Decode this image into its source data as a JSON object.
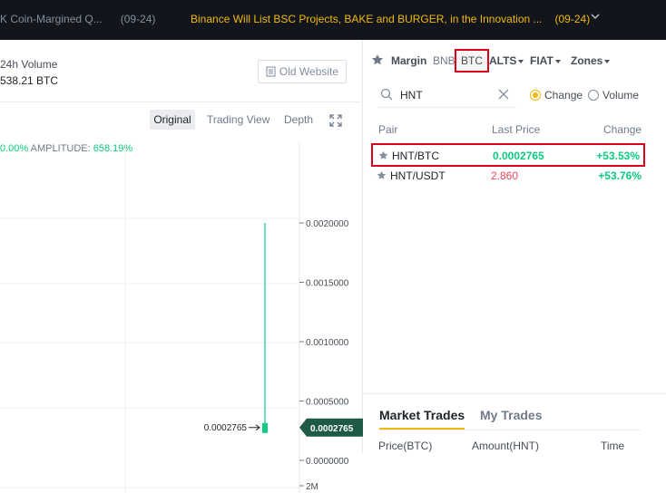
{
  "topbar": {
    "left_text": "K Coin-Margined Q...",
    "left_date": "(09-24)",
    "announcement": "Binance Will List BSC Projects, BAKE and BURGER, in the Innovation ...",
    "announcement_date": "(09-24)"
  },
  "left": {
    "volume_label": "24h Volume",
    "volume_value": "538.21 BTC",
    "old_website_label": "Old Website",
    "views": [
      "Original",
      "Trading View",
      "Depth"
    ],
    "stats": {
      "change": "0.00%",
      "amplitude_label": "AMPLITUDE:",
      "amplitude_value": "658.19%"
    }
  },
  "chart_data": {
    "type": "line",
    "y_ticks": [
      "0.0020000",
      "0.0015000",
      "0.0010000",
      "0.0005000",
      "0.0000000"
    ],
    "volume_tick": "2M",
    "last_price_label": "0.0002765",
    "last_price_tag": "0.0002765",
    "ylim": [
      0,
      0.002
    ],
    "series": [
      {
        "name": "",
        "values": [
          0.002,
          0.0002765
        ]
      }
    ]
  },
  "market": {
    "tabs": [
      "Margin",
      "BNB",
      "BTC",
      "ALTS",
      "FIAT",
      "Zones"
    ],
    "selected_tab": "BTC",
    "search_value": "HNT",
    "radio_change": "Change",
    "radio_volume": "Volume",
    "headers": {
      "pair": "Pair",
      "last_price": "Last Price",
      "change": "Change"
    },
    "rows": [
      {
        "pair": "HNT/BTC",
        "price": "0.0002765",
        "change": "+53.53%"
      },
      {
        "pair": "HNT/USDT",
        "price": "2.860",
        "change": "+53.76%"
      }
    ],
    "trades_tabs": {
      "active": "Market Trades",
      "other": "My Trades"
    },
    "trades_headers": {
      "price": "Price(BTC)",
      "amount": "Amount(HNT)",
      "time": "Time"
    }
  },
  "colors": {
    "accent": "#f0b90b",
    "up": "#0ecb81",
    "down": "#f6465d",
    "highlight": "#d9001b",
    "topbar": "#12161c"
  }
}
